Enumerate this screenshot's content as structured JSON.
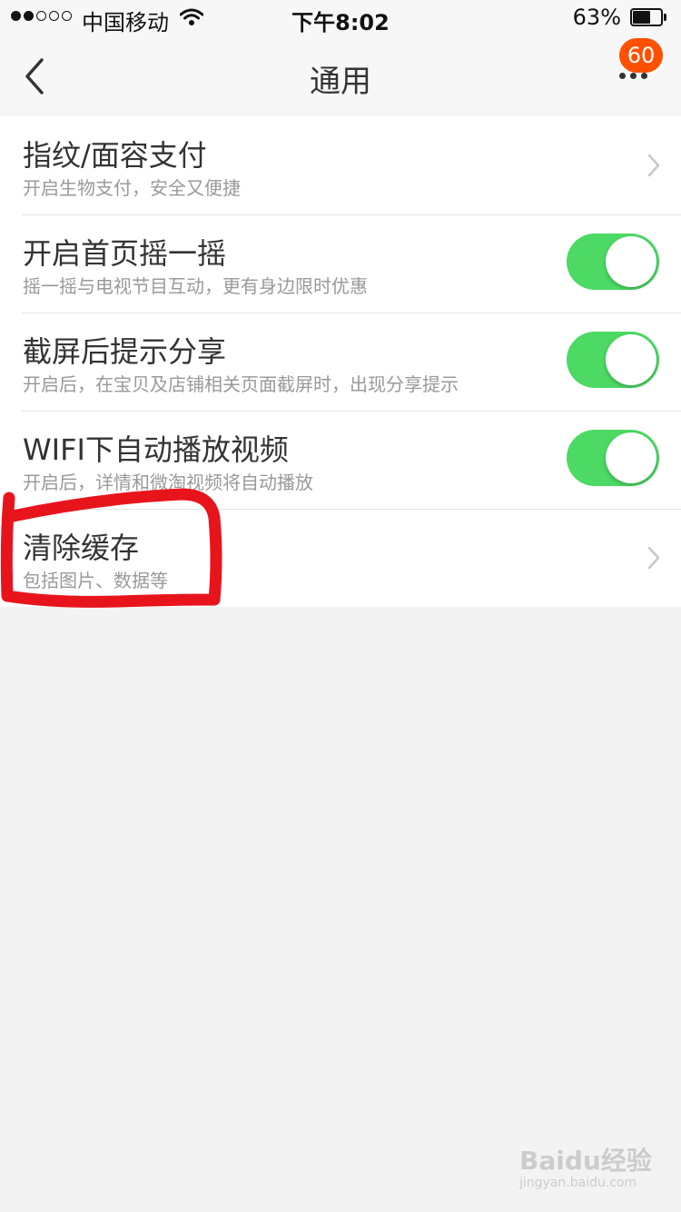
{
  "status_bar": {
    "signal_bars_filled": 2,
    "signal_bars_total": 5,
    "carrier": "中国移动",
    "time": "下午8:02",
    "battery_percent": "63%",
    "battery_level": 0.63
  },
  "nav": {
    "title": "通用",
    "badge_count": "60"
  },
  "settings": [
    {
      "title": "指纹/面容支付",
      "subtitle": "开启生物支付，安全又便捷",
      "control": "chevron"
    },
    {
      "title": "开启首页摇一摇",
      "subtitle": "摇一摇与电视节目互动，更有身边限时优惠",
      "control": "toggle",
      "toggle_on": true
    },
    {
      "title": "截屏后提示分享",
      "subtitle": "开启后，在宝贝及店铺相关页面截屏时，出现分享提示",
      "control": "toggle",
      "toggle_on": true
    },
    {
      "title": "WIFI下自动播放视频",
      "subtitle": "开启后，详情和微淘视频将自动播放",
      "control": "toggle",
      "toggle_on": true
    },
    {
      "title": "清除缓存",
      "subtitle": "包括图片、数据等",
      "control": "chevron"
    }
  ],
  "watermark": {
    "logo": "Baidu经验",
    "url": "jingyan.baidu.com"
  },
  "colors": {
    "toggle_on": "#4cd964",
    "badge": "#ff5000",
    "annotation": "#e8141c"
  }
}
